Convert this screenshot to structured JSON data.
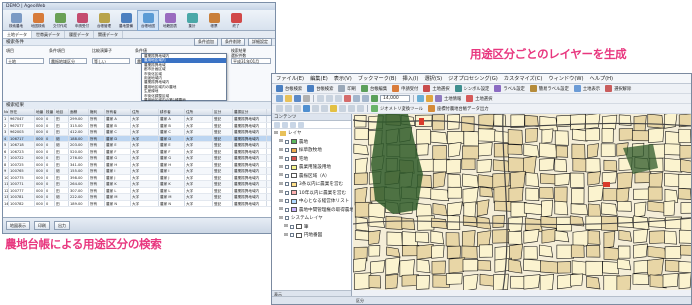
{
  "left_window": {
    "title": "DEMO  |  AgeoWeb",
    "ribbon": [
      {
        "label": "検索農地",
        "color": "#7b9ac4"
      },
      {
        "label": "地図検索",
        "color": "#d77b3a"
      },
      {
        "label": "交付作成",
        "color": "#6aa055"
      },
      {
        "label": "申請受付",
        "color": "#c44c6f"
      },
      {
        "label": "台帳管理",
        "color": "#b8a34a"
      },
      {
        "label": "農地整備",
        "color": "#4c7fbf"
      },
      {
        "label": "台帳地図",
        "color": "#5b9bd5",
        "active": true
      },
      {
        "label": "地籍図表",
        "color": "#9a6bbf"
      },
      {
        "label": "集計",
        "color": "#4aa8a8"
      },
      {
        "label": "帳票",
        "color": "#c97f3a"
      },
      {
        "label": "終了",
        "color": "#d14848"
      }
    ],
    "tabs": [
      {
        "label": "土地データ",
        "active": true
      },
      {
        "label": "世帯員データ"
      },
      {
        "label": "履歴データ"
      },
      {
        "label": "関連データ"
      }
    ],
    "condition": {
      "title": "検索条件",
      "buttons": [
        "条件追加",
        "条件削除",
        "詳細設定"
      ],
      "columns": [
        "項目",
        "条件項目",
        "比較演算子",
        "条件値"
      ],
      "values": [
        "土地",
        "農振地域区分",
        "等しい",
        "農業振興地域内"
      ],
      "dropdown_options": [
        "農業振興地域内",
        "農用地区域内",
        "農業振興地域",
        "都市計画区域",
        "市街化区域",
        "用途地域内",
        "農業振興地域内",
        "農用地区域内の農地",
        "生産緑地",
        "市街化調整区域",
        "農用地区域内の第1種農地"
      ],
      "dropdown_selected": 1,
      "side_labels": [
        "検索結果",
        "選択件数",
        "平成31年01月"
      ]
    },
    "grid": {
      "title": "検索結果",
      "headers": [
        "No",
        "所在",
        "地番",
        "枝番",
        "地目",
        "面積",
        "権利",
        "所有者",
        "住所",
        "耕作者",
        "住所",
        "区分",
        "農振区分"
      ],
      "rows": [
        [
          "1",
          "967047",
          "000",
          "0",
          "田",
          "299.00",
          "所有",
          "農家 A",
          "大字",
          "農家 A",
          "大字",
          "登記",
          "農業振興地域内"
        ],
        [
          "2",
          "967077",
          "000",
          "0",
          "田",
          "315.00",
          "所有",
          "農家 B",
          "大字",
          "農家 B",
          "大字",
          "登記",
          "農業振興地域内"
        ],
        [
          "3",
          "962003",
          "000",
          "0",
          "田",
          "412.00",
          "所有",
          "農家 C",
          "大字",
          "農家 C",
          "大字",
          "登記",
          "農業振興地域内"
        ],
        [
          "4",
          "106717",
          "000",
          "0",
          "畑",
          "188.00",
          "所有",
          "農家 D",
          "大字",
          "農家 D",
          "大字",
          "登記",
          "農業振興地域内"
        ],
        [
          "5",
          "106718",
          "000",
          "0",
          "畑",
          "203.00",
          "所有",
          "農家 E",
          "大字",
          "農家 E",
          "大字",
          "登記",
          "農業振興地域内"
        ],
        [
          "6",
          "106723",
          "000",
          "0",
          "田",
          "520.00",
          "所有",
          "農家 F",
          "大字",
          "農家 F",
          "大字",
          "登記",
          "農業振興地域内"
        ],
        [
          "7",
          "100722",
          "000",
          "0",
          "田",
          "276.00",
          "所有",
          "農家 G",
          "大字",
          "農家 G",
          "大字",
          "登記",
          "農業振興地域内"
        ],
        [
          "8",
          "100725",
          "000",
          "0",
          "田",
          "341.00",
          "所有",
          "農家 H",
          "大字",
          "農家 H",
          "大字",
          "登記",
          "農業振興地域内"
        ],
        [
          "9",
          "100765",
          "000",
          "0",
          "畑",
          "155.00",
          "所有",
          "農家 I",
          "大字",
          "農家 I",
          "大字",
          "登記",
          "農業振興地域内"
        ],
        [
          "10",
          "100775",
          "000",
          "0",
          "田",
          "398.00",
          "所有",
          "農家 J",
          "大字",
          "農家 J",
          "大字",
          "登記",
          "農業振興地域内"
        ],
        [
          "11",
          "100771",
          "000",
          "0",
          "田",
          "264.00",
          "所有",
          "農家 K",
          "大字",
          "農家 K",
          "大字",
          "登記",
          "農業振興地域内"
        ],
        [
          "12",
          "100777",
          "000",
          "0",
          "田",
          "307.00",
          "所有",
          "農家 L",
          "大字",
          "農家 L",
          "大字",
          "登記",
          "農業振興地域内"
        ],
        [
          "13",
          "100781",
          "000",
          "0",
          "畑",
          "222.00",
          "所有",
          "農家 M",
          "大字",
          "農家 M",
          "大字",
          "登記",
          "農業振興地域内"
        ],
        [
          "14",
          "100782",
          "000",
          "0",
          "田",
          "189.00",
          "所有",
          "農家 N",
          "大字",
          "農家 N",
          "大字",
          "登記",
          "農業振興地域内"
        ]
      ],
      "selected_row": 3
    },
    "status_buttons": [
      "地図表示",
      "印刷",
      "出力"
    ]
  },
  "right_window": {
    "menu": [
      "ファイル(E)",
      "編集(E)",
      "表示(V)",
      "ブックマーク(B)",
      "挿入(I)",
      "選択(S)",
      "ジオプロセシング(G)",
      "カスタマイズ(C)",
      "ウィンドウ(W)",
      "ヘルプ(H)"
    ],
    "toolbar1": [
      "台帳検索",
      "台帳検索",
      "印刷",
      "台帳編集",
      "申請受付",
      "土地選択",
      "シンボル設定",
      "ラベル設定",
      "簡易ラベル設定",
      "土地表示",
      "選択解除"
    ],
    "toolbar2": [
      "14,000",
      "土地情報",
      "土地選択"
    ],
    "toolbar3": [
      "ジオメトリ変換ツール",
      "座標付農地台帳データ出力"
    ],
    "panel_title": "コンテンツ",
    "layers_root": "レイヤ",
    "layers": [
      {
        "label": "農地",
        "indent": 1,
        "swatch": "#5cb85c"
      },
      {
        "label": "採草放牧地",
        "indent": 1,
        "swatch": "#f0ad4e"
      },
      {
        "label": "宅地",
        "indent": 1,
        "swatch": "#d9534f"
      },
      {
        "label": "農業用施設用地",
        "indent": 1,
        "swatch": "#f5f58c"
      },
      {
        "label": "農振区域（A）",
        "indent": 1,
        "swatch": "#ffffff"
      },
      {
        "label": "3条以内に農業を営む",
        "indent": 1,
        "swatch": "#ffe08a"
      },
      {
        "label": "10年以内に農業を営む",
        "indent": 1,
        "swatch": "#ffb0b0"
      },
      {
        "label": "中心となる経営体リスト",
        "indent": 1,
        "swatch": "#b0d8ff"
      },
      {
        "label": "農地中間管理権の取得農地",
        "indent": 1,
        "swatch": "#c8b0ff"
      },
      {
        "label": "システムレイヤ",
        "indent": 1,
        "swatch": ""
      },
      {
        "label": "筆",
        "indent": 2,
        "swatch": "#ffffff"
      },
      {
        "label": "円地番図",
        "indent": 2,
        "swatch": "#ffffff"
      }
    ],
    "panel_footer": "表示",
    "status": "区分"
  },
  "captions": {
    "top_right": "用途区分ごとのレイヤーを生成",
    "bottom_left": "農地台帳による用途区分の検索"
  },
  "colors": {
    "caption": "#e8377f",
    "map_background": "#f5eed8",
    "map_parcel": "#fbf3cf",
    "map_parcel_alt": "#e8d6a6",
    "map_line": "#1a1a1a",
    "map_forest": "#2f5a2a",
    "map_highlight": "#d93a2b"
  }
}
